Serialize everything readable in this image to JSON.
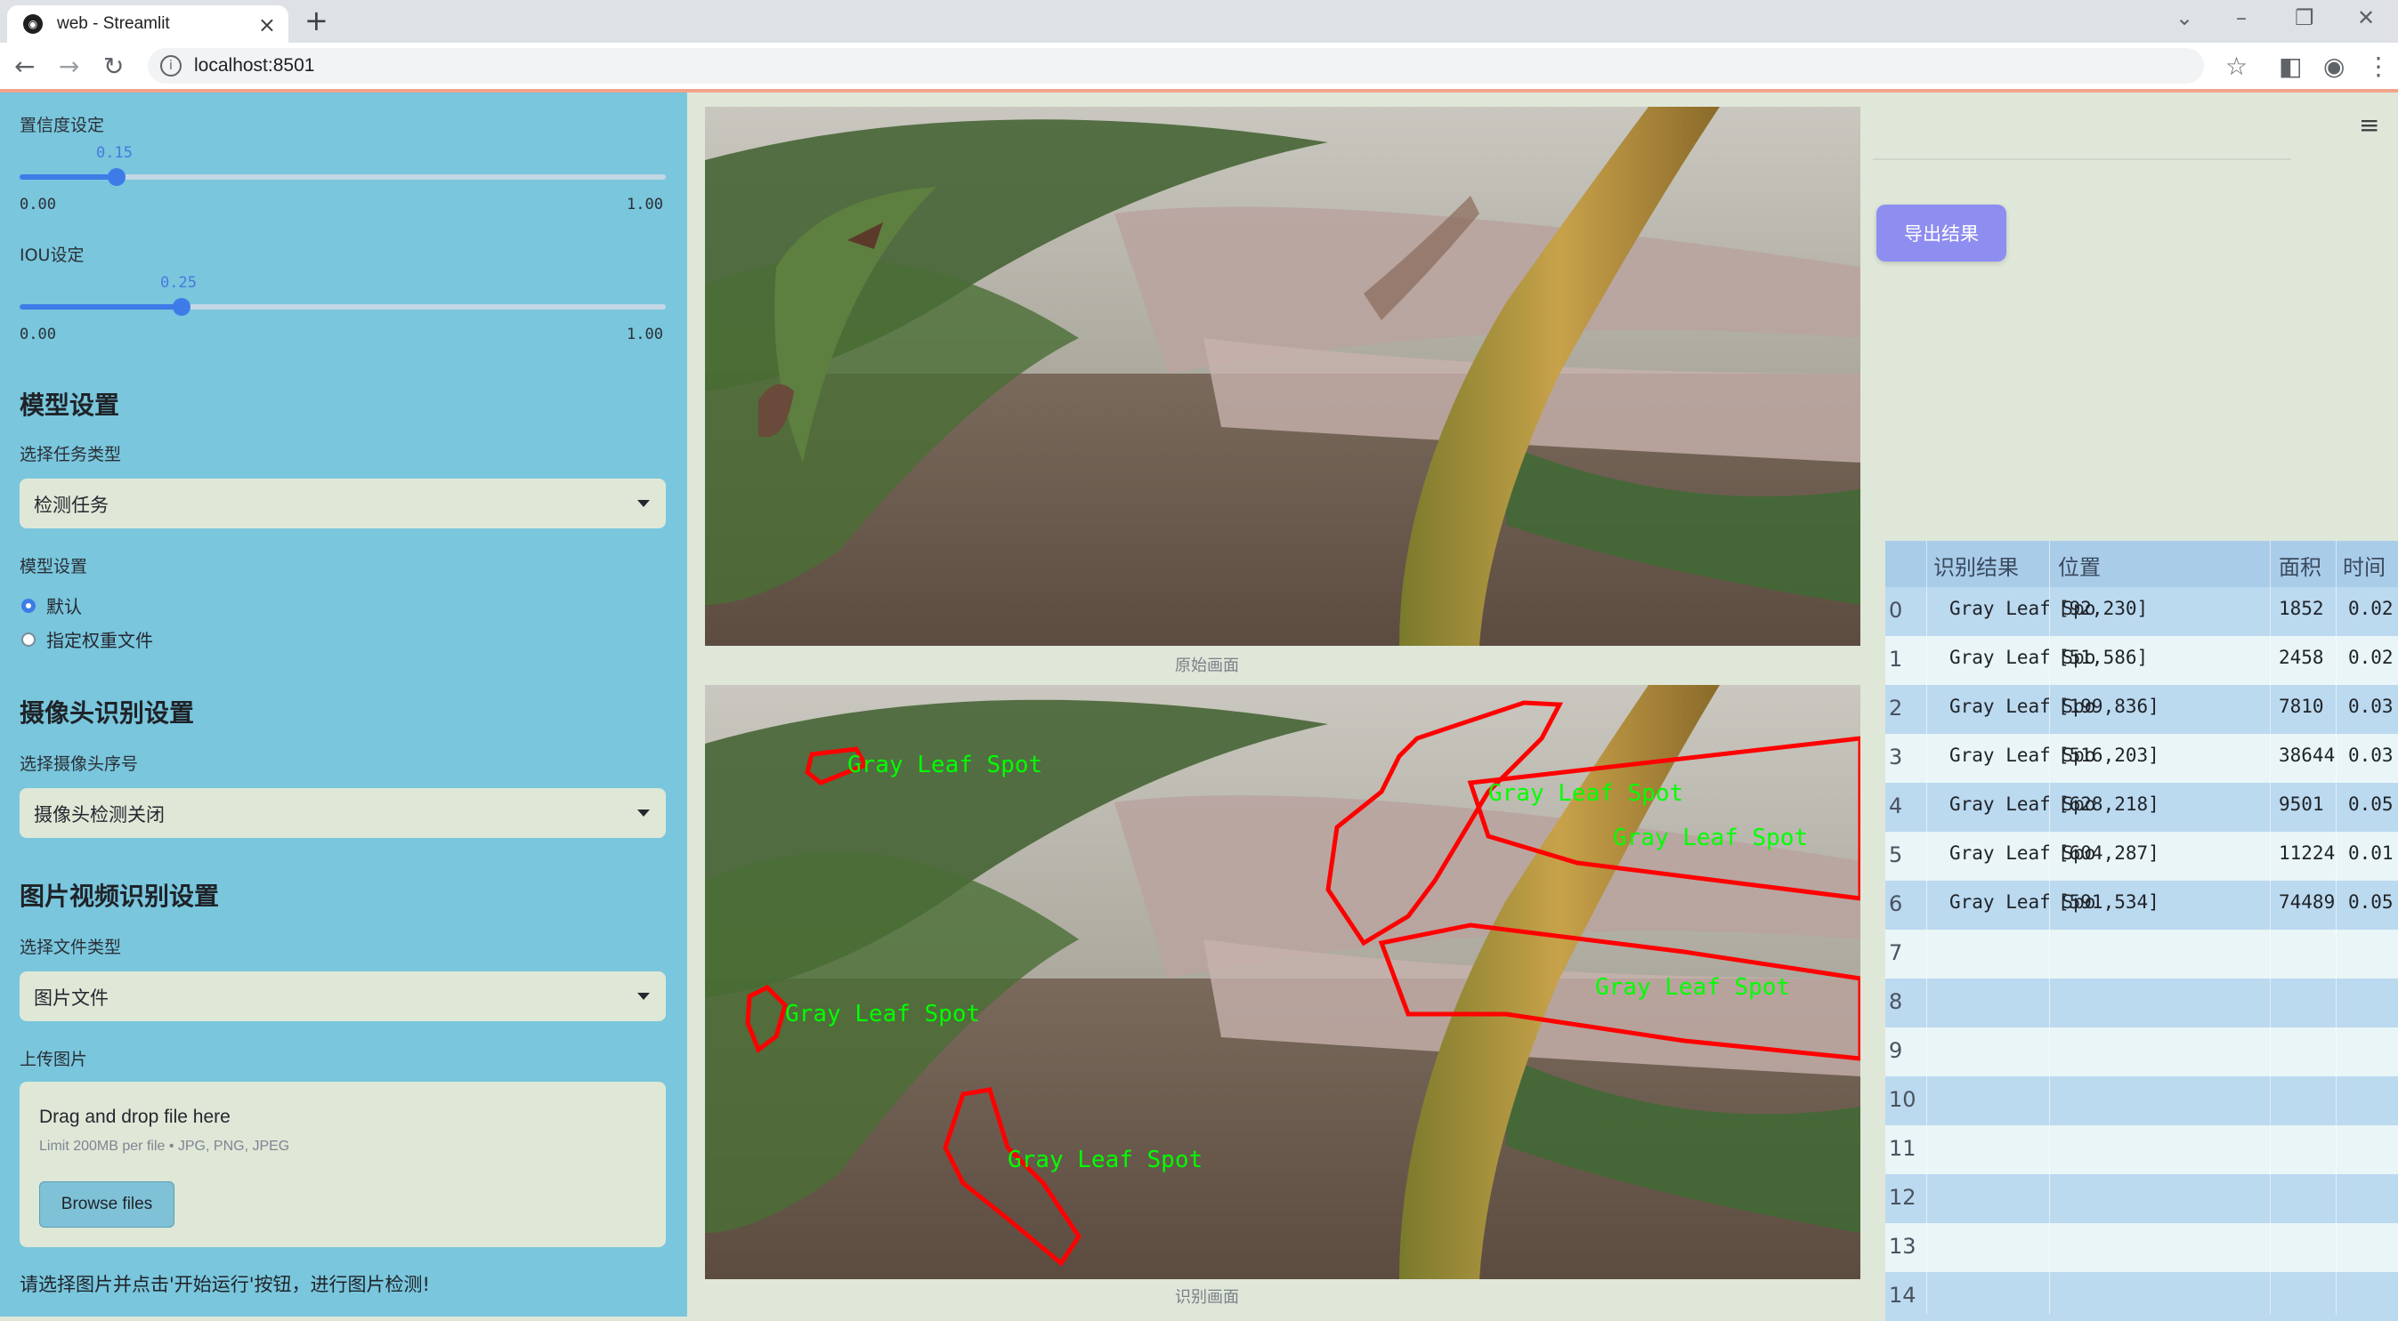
{
  "browser": {
    "tab_title": "web - Streamlit",
    "url": "localhost:8501"
  },
  "sidebar": {
    "confidence": {
      "label": "置信度设定",
      "value": 0.15,
      "value_text": "0.15",
      "min": "0.00",
      "max": "1.00"
    },
    "iou": {
      "label": "IOU设定",
      "value": 0.25,
      "value_text": "0.25",
      "min": "0.00",
      "max": "1.00"
    },
    "model_section": {
      "title": "模型设置",
      "task_label": "选择任务类型",
      "task_value": "检测任务",
      "model_label": "模型设置",
      "radio_default": "默认",
      "radio_custom": "指定权重文件",
      "selected": "默认"
    },
    "camera_section": {
      "title": "摄像头识别设置",
      "camera_label": "选择摄像头序号",
      "camera_value": "摄像头检测关闭"
    },
    "media_section": {
      "title": "图片视频识别设置",
      "type_label": "选择文件类型",
      "type_value": "图片文件",
      "upload_label": "上传图片",
      "upload_title": "Drag and drop file here",
      "upload_hint": "Limit 200MB per file • JPG, PNG, JPEG",
      "browse_label": "Browse files"
    },
    "hint": "请选择图片并点击'开始运行'按钮，进行图片检测!"
  },
  "main": {
    "original_caption": "原始画面",
    "result_caption": "识别画面",
    "detection_label": "Gray Leaf Spot"
  },
  "right": {
    "export_label": "导出结果",
    "table": {
      "headers": [
        "识别结果",
        "位置",
        "面积",
        "时间"
      ],
      "rows": [
        {
          "idx": "0",
          "result": "Gray Leaf Spo",
          "pos": "[92,230]",
          "area": "1852",
          "time": "0.02"
        },
        {
          "idx": "1",
          "result": "Gray Leaf Spo",
          "pos": "[51,586]",
          "area": "2458",
          "time": "0.02"
        },
        {
          "idx": "2",
          "result": "Gray Leaf Spo",
          "pos": "[199,836]",
          "area": "7810",
          "time": "0.03"
        },
        {
          "idx": "3",
          "result": "Gray Leaf Spo",
          "pos": "[516,203]",
          "area": "38644",
          "time": "0.03"
        },
        {
          "idx": "4",
          "result": "Gray Leaf Spo",
          "pos": "[628,218]",
          "area": "9501",
          "time": "0.05"
        },
        {
          "idx": "5",
          "result": "Gray Leaf Spo",
          "pos": "[604,287]",
          "area": "11224",
          "time": "0.01"
        },
        {
          "idx": "6",
          "result": "Gray Leaf Spo",
          "pos": "[591,534]",
          "area": "74489",
          "time": "0.05"
        },
        {
          "idx": "7",
          "result": "",
          "pos": "",
          "area": "",
          "time": ""
        },
        {
          "idx": "8",
          "result": "",
          "pos": "",
          "area": "",
          "time": ""
        },
        {
          "idx": "9",
          "result": "",
          "pos": "",
          "area": "",
          "time": ""
        },
        {
          "idx": "10",
          "result": "",
          "pos": "",
          "area": "",
          "time": ""
        },
        {
          "idx": "11",
          "result": "",
          "pos": "",
          "area": "",
          "time": ""
        },
        {
          "idx": "12",
          "result": "",
          "pos": "",
          "area": "",
          "time": ""
        },
        {
          "idx": "13",
          "result": "",
          "pos": "",
          "area": "",
          "time": ""
        },
        {
          "idx": "14",
          "result": "",
          "pos": "",
          "area": "",
          "time": ""
        }
      ]
    }
  },
  "colors": {
    "sidebar_bg": "#79c6dd",
    "accent": "#3f7be8",
    "export_button": "#8e8df0",
    "detection_outline": "#ff0000",
    "detection_text": "#00ff00"
  }
}
